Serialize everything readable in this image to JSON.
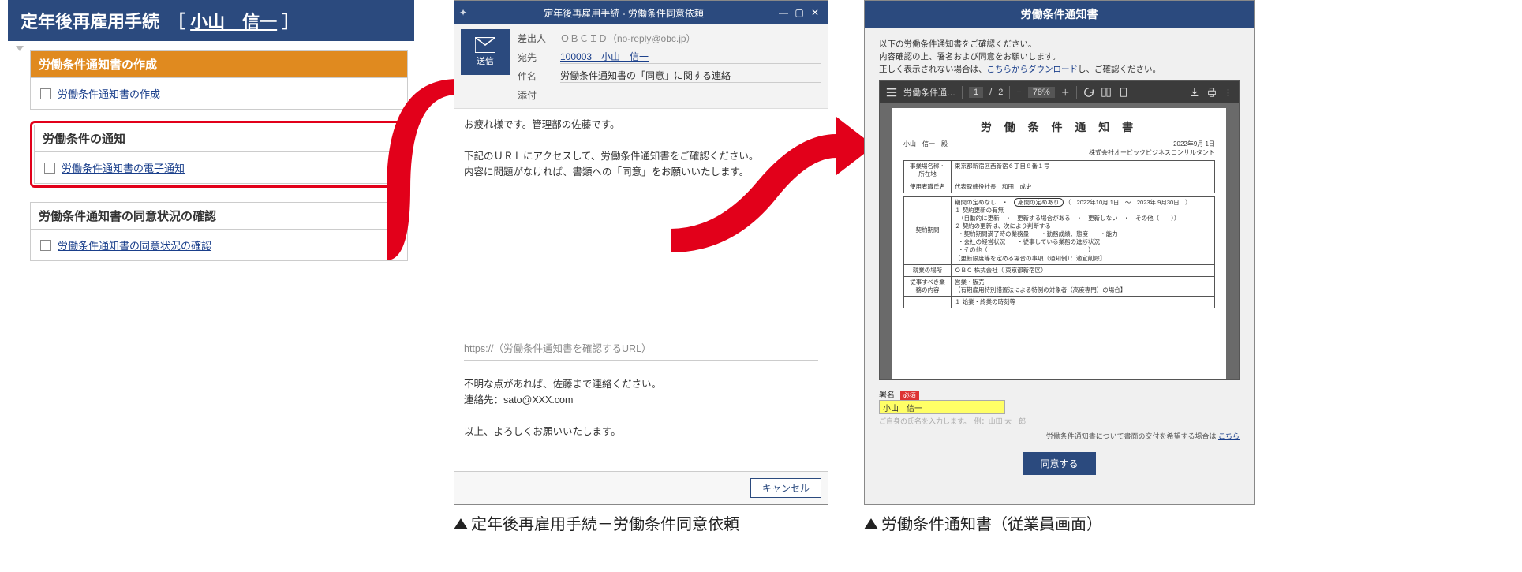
{
  "panel1": {
    "title_prefix": "定年後再雇用手続　［ ",
    "title_name": "小山　信一",
    "title_suffix": " ］",
    "section1_title": "労働条件通知書の作成",
    "section1_link": "労働条件通知書の作成",
    "section2_title": "労働条件の通知",
    "section2_link": "労働条件通知書の電子通知",
    "section3_title": "労働条件通知書の同意状況の確認",
    "section3_link": "労働条件通知書の同意状況の確認"
  },
  "panel2": {
    "window_title": "定年後再雇用手続 - 労働条件同意依頼",
    "send_label": "送信",
    "from_label": "差出人",
    "from_value": "ＯＢＣＩＤ（no-reply@obc.jp）",
    "to_label": "宛先",
    "to_value": "100003　小山　信一",
    "subject_label": "件名",
    "subject_value": "労働条件通知書の「同意」に関する連絡",
    "attach_label": "添付",
    "body_l1": "お疲れ様です。管理部の佐藤です。",
    "body_l2": "下記のＵＲＬにアクセスして、労働条件通知書をご確認ください。",
    "body_l3": "内容に問題がなければ、書類への「同意」をお願いいたします。",
    "url_placeholder": "https://（労働条件通知書を確認するURL）",
    "body_l4": "不明な点があれば、佐藤まで連絡ください。",
    "body_l5": "連絡先：sato@XXX.com",
    "body_l6": "以上、よろしくお願いいたします。",
    "cancel": "キャンセル"
  },
  "panel3": {
    "title": "労働条件通知書",
    "intro1": "以下の労働条件通知書をご確認ください。",
    "intro2": "内容確認の上、署名および同意をお願いします。",
    "intro3_a": "正しく表示されない場合は、",
    "intro3_link": "こちらからダウンロード",
    "intro3_b": "し、ご確認ください。",
    "pdf_name": "労働条件通…",
    "pdf_page_cur": "1",
    "pdf_page_sep": "/",
    "pdf_page_total": "2",
    "pdf_zoom": "78%",
    "doc_title": "労 働 条 件 通 知 書",
    "doc_date": "2022年9月 1日",
    "doc_to": "小山　信一　殿",
    "doc_company": "株式会社オービックビジネスコンサルタント",
    "doc_row_place_l": "事業場名称・所在地",
    "doc_row_place_v": "東京都新宿区西新宿６丁目８番１号",
    "doc_row_emp_l": "使用者職氏名",
    "doc_row_emp_v": "代表取締役社長　和田　成史",
    "tbl_period_l": "契約期間",
    "tbl_period_none": "期間の定めなし",
    "tbl_period_yes": "期間の定めあり",
    "tbl_period_range": "（　2022年10月 1日　～　2023年 9月30日　）",
    "tbl_renew_h": "１ 契約更新の有無",
    "tbl_renew_opt": "（自動的に更新　・　更新する場合がある　・　更新しない　・　その他（　　））",
    "tbl_renew2_h": "２ 契約の更新は、次により判断する",
    "tbl_renew2_a": "・契約期間満了時の業務量　　・勤務成績、態度　　・能力",
    "tbl_renew2_b": "・会社の経営状況　　・従事している業務の進捗状況",
    "tbl_renew2_c": "・その他（　　　　　　　　　　　　　　　　　）",
    "tbl_renew3_h": "【更新限度等を定める場合の事項（通知例）：適宜削除】",
    "tbl_place_l": "就業の場所",
    "tbl_place_v": "ＯＢＣ 株式会社（ 東京都新宿区）",
    "tbl_job_l": "従事すべき業務の内容",
    "tbl_job_v": "営業・販売",
    "tbl_job_note": "【有期雇用特別措置法による特例の対象者（高度専門）の場合】",
    "tbl_time_l": "",
    "tbl_time_v": "１ 始業・終業の時刻等",
    "sign_label": "署名",
    "sign_req": "必須",
    "sign_value": "小山　信一",
    "sign_hint": "ご自身の氏名を入力します。　例：山田 太一郎",
    "note_right_a": "労働条件通知書について書面の交付を希望する場合は ",
    "note_right_link": "こちら",
    "agree": "同意する"
  },
  "captions": {
    "c2": "定年後再雇用手続－労働条件同意依頼",
    "c3": "労働条件通知書（従業員画面）"
  }
}
